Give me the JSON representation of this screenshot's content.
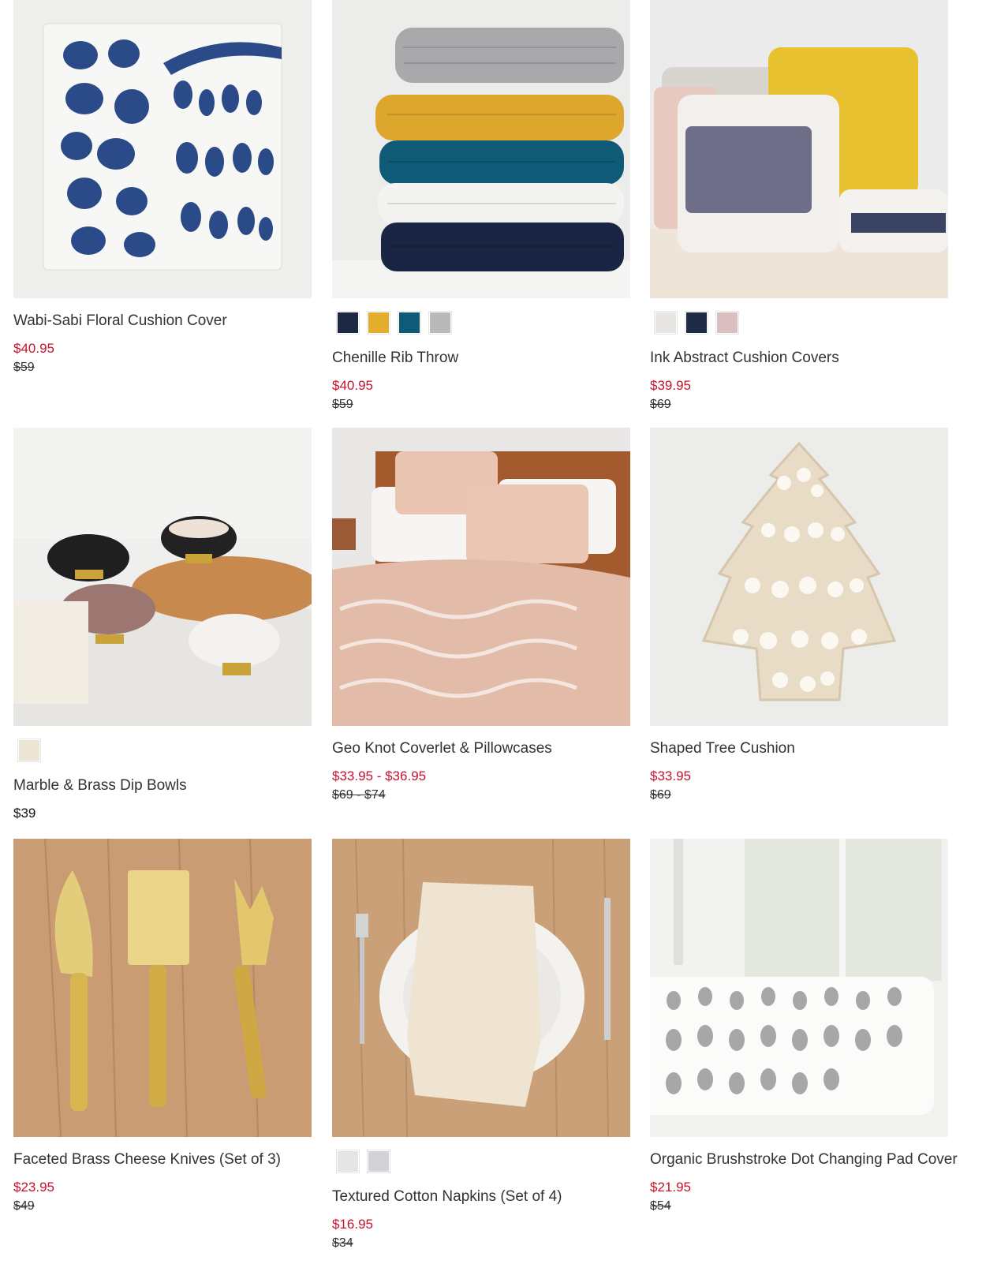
{
  "products": [
    {
      "title": "Wabi-Sabi Floral Cushion Cover",
      "sale_price": "$40.95",
      "original_price": "$59",
      "image": "blue-floral-cushion-image",
      "swatches": []
    },
    {
      "title": "Chenille Rib Throw",
      "sale_price": "$40.95",
      "original_price": "$59",
      "image": "stacked-knit-throws-image",
      "swatches": [
        "#1b2743",
        "#e4ad2c",
        "#0f5a77",
        "#b9b9b9"
      ]
    },
    {
      "title": "Ink Abstract Cushion Covers",
      "sale_price": "$39.95",
      "original_price": "$69",
      "image": "abstract-cushions-image",
      "swatches": [
        "#e8e6e3",
        "#1f2a44",
        "#d9bfc0"
      ]
    },
    {
      "title": "Marble & Brass Dip Bowls",
      "regular_price": "$39",
      "image": "marble-dip-bowls-image",
      "swatches": [
        "#ece4d4"
      ]
    },
    {
      "title": "Geo Knot Coverlet & Pillowcases",
      "sale_price": "$33.95 - $36.95",
      "original_price": "$69 - $74",
      "image": "geo-knot-bedding-image",
      "swatches": []
    },
    {
      "title": "Shaped Tree Cushion",
      "sale_price": "$33.95",
      "original_price": "$69",
      "image": "tree-cushion-image",
      "swatches": []
    },
    {
      "title": "Faceted Brass Cheese Knives (Set of 3)",
      "sale_price": "$23.95",
      "original_price": "$49",
      "image": "brass-cheese-knives-image",
      "swatches": []
    },
    {
      "title": "Textured Cotton Napkins (Set of 4)",
      "sale_price": "$16.95",
      "original_price": "$34",
      "image": "cotton-napkins-image",
      "swatches": [
        "#e6e4e6",
        "#d3d2d6"
      ]
    },
    {
      "title": "Organic Brushstroke Dot Changing Pad Cover",
      "sale_price": "$21.95",
      "original_price": "$54",
      "image": "changing-pad-image",
      "swatches": []
    }
  ]
}
